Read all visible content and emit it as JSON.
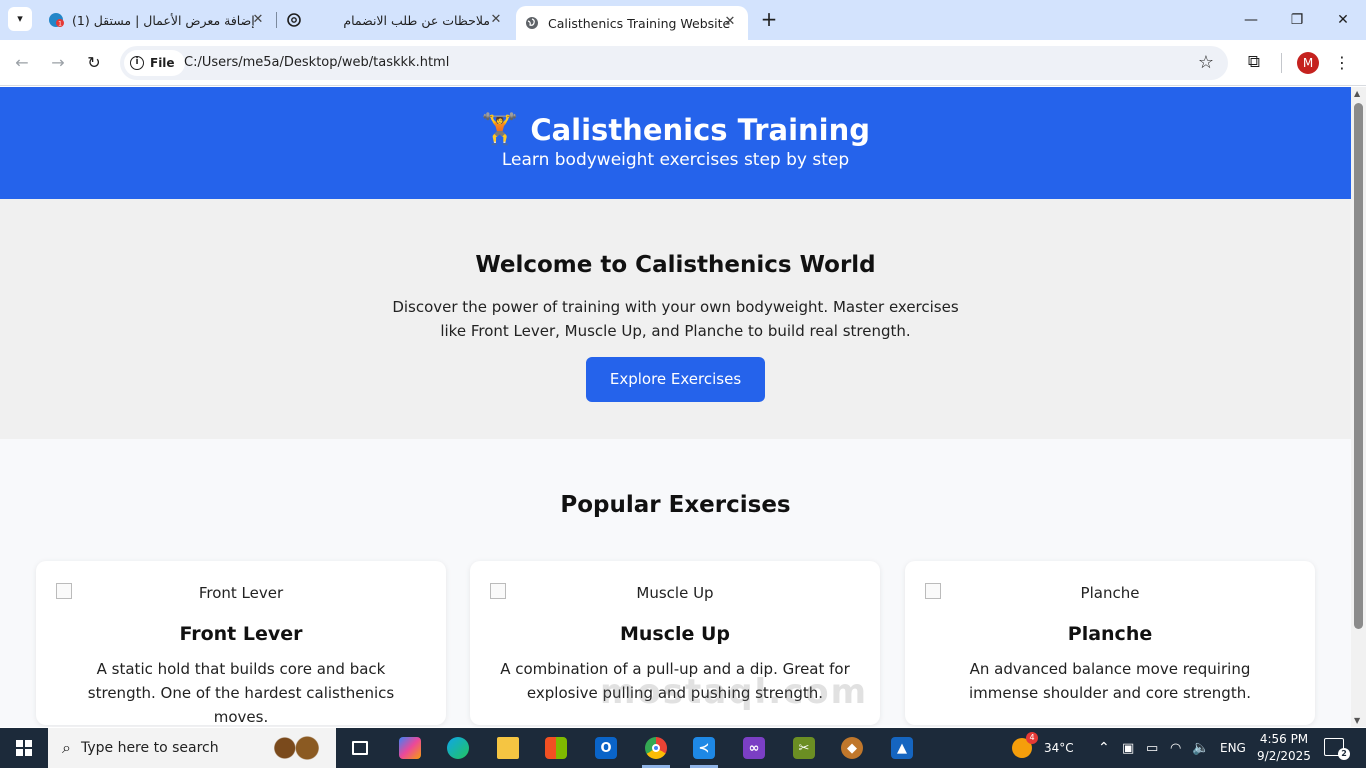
{
  "browser": {
    "tabs": [
      {
        "label": "(1) إضافة معرض الأعمال | مستقل",
        "badge": "1",
        "active": false
      },
      {
        "label": "ملاحظات عن طلب الانضمام",
        "active": false
      },
      {
        "label": "Calisthenics Training Website",
        "active": true
      }
    ],
    "new_tab": "+",
    "address": {
      "chip_label": "File",
      "url": "C:/Users/me5a/Desktop/web/taskkk.html"
    },
    "profile_initial": "M"
  },
  "page": {
    "header": {
      "logo_emoji": "🏋️",
      "title": "Calisthenics Training",
      "subtitle": "Learn bodyweight exercises step by step"
    },
    "hero": {
      "heading": "Welcome to Calisthenics World",
      "text": "Discover the power of training with your own bodyweight. Master exercises like Front Lever, Muscle Up, and Planche to build real strength.",
      "button": "Explore Exercises"
    },
    "exercises": {
      "heading": "Popular Exercises",
      "cards": [
        {
          "img_alt": "Front Lever",
          "title": "Front Lever",
          "description": "A static hold that builds core and back strength. One of the hardest calisthenics moves."
        },
        {
          "img_alt": "Muscle Up",
          "title": "Muscle Up",
          "description": "A combination of a pull-up and a dip. Great for explosive pulling and pushing strength."
        },
        {
          "img_alt": "Planche",
          "title": "Planche",
          "description": "An advanced balance move requiring immense shoulder and core strength."
        }
      ]
    }
  },
  "watermark": "mostaql.com",
  "taskbar": {
    "search_placeholder": "Type here to search",
    "weather": {
      "temp": "34°C",
      "badge": "4"
    },
    "language": "ENG",
    "time": "4:56 PM",
    "date": "9/2/2025",
    "notification_count": "2"
  },
  "colors": {
    "accent": "#2563eb",
    "tabstrip": "#d3e3fd",
    "taskbar": "#1c2a3a"
  }
}
